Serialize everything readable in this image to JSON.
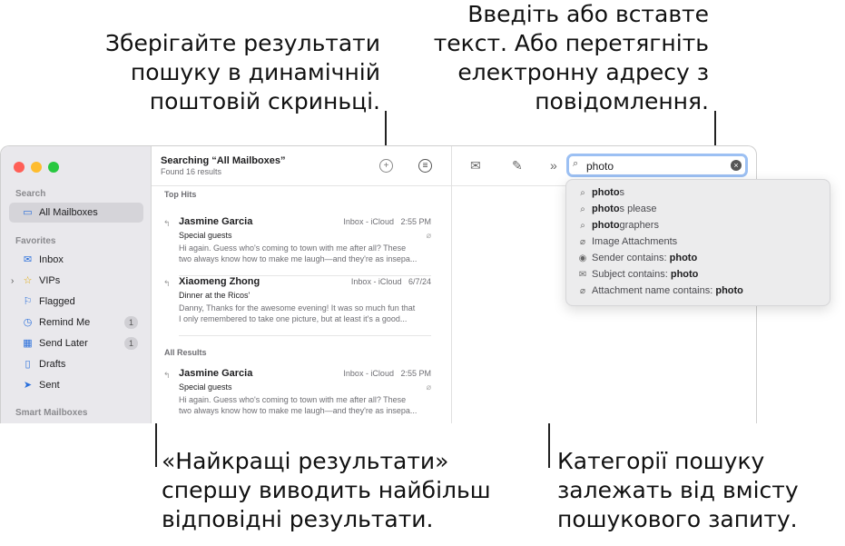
{
  "callouts": {
    "top_left": [
      "Зберігайте результати",
      "пошуку в динамічній",
      "поштовій скриньці."
    ],
    "top_right": [
      "Введіть або вставте",
      "текст. Або перетягніть",
      "електронну адресу з",
      "повідомлення."
    ],
    "bottom_left": [
      "«Найкращі результати»",
      "спершу виводить найбільш",
      "відповідні результати."
    ],
    "bottom_right": [
      "Категорії пошуку",
      "залежать від вмісту",
      "пошукового запиту."
    ]
  },
  "sidebar": {
    "search_section": "Search",
    "all_mailboxes": "All Mailboxes",
    "favorites_section": "Favorites",
    "items": [
      {
        "label": "Inbox",
        "icon": "inbox-icon",
        "badge": ""
      },
      {
        "label": "VIPs",
        "icon": "star-icon",
        "badge": ""
      },
      {
        "label": "Flagged",
        "icon": "flag-icon",
        "badge": ""
      },
      {
        "label": "Remind Me",
        "icon": "clock-icon",
        "badge": "1"
      },
      {
        "label": "Send Later",
        "icon": "calendar-icon",
        "badge": "1"
      },
      {
        "label": "Drafts",
        "icon": "document-icon",
        "badge": ""
      },
      {
        "label": "Sent",
        "icon": "paper-plane-icon",
        "badge": ""
      }
    ],
    "smart_section": "Smart Mailboxes"
  },
  "list": {
    "title": "Searching “All Mailboxes”",
    "subtitle": "Found 16 results",
    "top_hits_label": "Top Hits",
    "all_results_label": "All Results",
    "messages": [
      {
        "from": "Jasmine Garcia",
        "mailbox": "Inbox - iCloud",
        "time": "2:55 PM",
        "subject": "Special guests",
        "preview": "Hi again. Guess who's coming to town with me after all? These\ntwo always know how to make me laugh—and they're as insepa..."
      },
      {
        "from": "Xiaomeng Zhong",
        "mailbox": "Inbox - iCloud",
        "time": "6/7/24",
        "subject": "Dinner at the Ricos'",
        "preview": "Danny, Thanks for the awesome evening! It was so much fun that\nI only remembered to take one picture, but at least it's a good..."
      },
      {
        "from": "Jasmine Garcia",
        "mailbox": "Inbox - iCloud",
        "time": "2:55 PM",
        "subject": "Special guests",
        "preview": "Hi again. Guess who's coming to town with me after all? These\ntwo always know how to make me laugh—and they're as insepa..."
      }
    ]
  },
  "search": {
    "value": "photo"
  },
  "suggestions": [
    {
      "icon": "search-icon",
      "bold": "photo",
      "rest": "s",
      "prefix": ""
    },
    {
      "icon": "search-icon",
      "bold": "photo",
      "rest": "s please",
      "prefix": ""
    },
    {
      "icon": "search-icon",
      "bold": "photo",
      "rest": "graphers",
      "prefix": ""
    },
    {
      "icon": "paperclip-icon",
      "bold": "",
      "rest": "",
      "prefix": "Image Attachments"
    },
    {
      "icon": "person-icon",
      "bold": "photo",
      "rest": "",
      "prefix": "Sender contains: "
    },
    {
      "icon": "envelope-icon",
      "bold": "photo",
      "rest": "",
      "prefix": "Subject contains: "
    },
    {
      "icon": "paperclip-icon",
      "bold": "photo",
      "rest": "",
      "prefix": "Attachment name contains: "
    }
  ]
}
